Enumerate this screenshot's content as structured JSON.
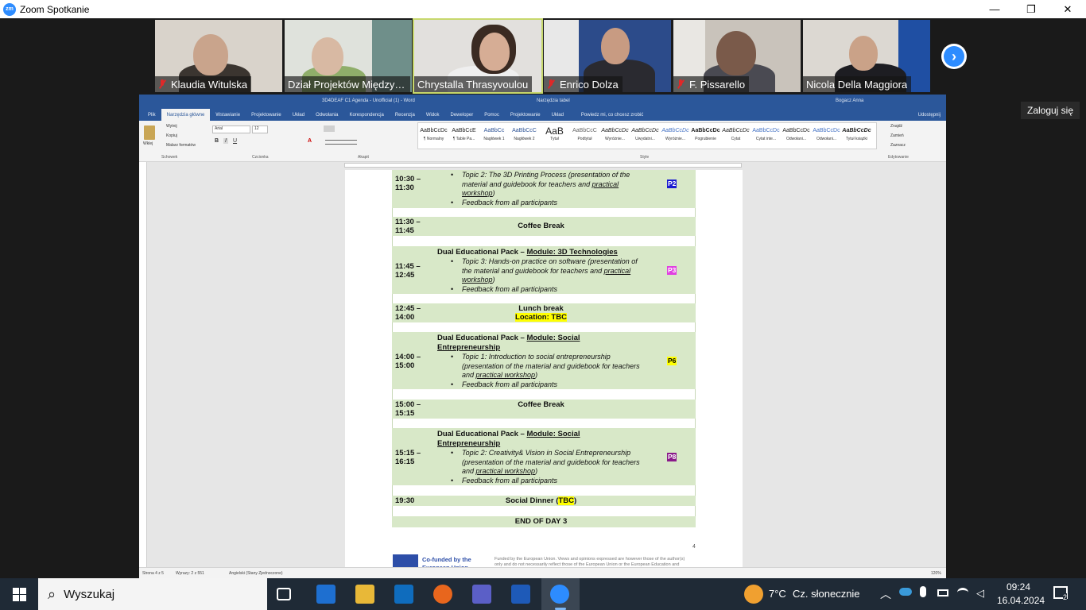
{
  "window": {
    "logo": "zm",
    "title": "Zoom Spotkanie",
    "minimize": "—",
    "maximize": "❐",
    "close": "✕"
  },
  "participants": [
    {
      "name": "Klaudia Witulska",
      "muted": true
    },
    {
      "name": "Dział Projektów Międzyn...",
      "muted": false
    },
    {
      "name": "Chrystalla Thrasyvoulou",
      "muted": false,
      "active": true
    },
    {
      "name": "Enrico Dolza",
      "muted": true
    },
    {
      "name": "F. Pissarello",
      "muted": true
    },
    {
      "name": "Nicola Della Maggiora",
      "muted": false
    }
  ],
  "next_icon": "›",
  "login_tooltip": "Zaloguj się",
  "word": {
    "doc_title": "3D4DEAF C1 Agenda - Unofficial (1) - Word",
    "context_tab": "Narzędzia tabel",
    "user": "Bogacz Anna",
    "tabs": [
      "Plik",
      "Narzędzia główne",
      "Wstawianie",
      "Projektowanie",
      "Układ",
      "Odwołania",
      "Korespondencja",
      "Recenzja",
      "Widok",
      "Deweloper",
      "Pomoc",
      "Projektowanie",
      "Układ"
    ],
    "tell_me": "Powiedz mi, co chcesz zrobić",
    "share": "Udostępnij",
    "clipboard": {
      "paste": "Wklej",
      "cut": "Wytnij",
      "copy": "Kopiuj",
      "painter": "Malarz formatów",
      "label": "Schowek"
    },
    "font": {
      "name": "Arial",
      "size": "12",
      "label": "Czcionka"
    },
    "paragraph_label": "Akapit",
    "styles_label": "Style",
    "styles": [
      {
        "sample": "AaBbCcDc",
        "name": "¶ Normalny"
      },
      {
        "sample": "AaBbCcE",
        "name": "¶ Table Pa..."
      },
      {
        "sample": "AaBbCc",
        "name": "Nagłówek 1"
      },
      {
        "sample": "AaBbCcC",
        "name": "Nagłówek 2"
      },
      {
        "sample": "AaB",
        "name": "Tytuł"
      },
      {
        "sample": "AaBbCcC",
        "name": "Podtytuł"
      },
      {
        "sample": "AaBbCcDc",
        "name": "Wyróżnie..."
      },
      {
        "sample": "AaBbCcDc",
        "name": "Uwydatni..."
      },
      {
        "sample": "AaBbCcDc",
        "name": "Wyróżnie..."
      },
      {
        "sample": "AaBbCcDc",
        "name": "Pogrubienie"
      },
      {
        "sample": "AaBbCcDc",
        "name": "Cytat"
      },
      {
        "sample": "AaBbCcDc",
        "name": "Cytat inte..."
      },
      {
        "sample": "AaBbCcDc",
        "name": "Odwołani..."
      },
      {
        "sample": "AaBbCcDc",
        "name": "Odwołani..."
      },
      {
        "sample": "AaBbCcDc",
        "name": "Tytuł książki"
      }
    ],
    "editing": {
      "find": "Znajdź",
      "replace": "Zamień",
      "select": "Zaznacz",
      "label": "Edytowanie"
    },
    "status": {
      "page": "Strona 4 z 5",
      "words": "Wyrazy: 2 z 551",
      "lang": "Angielski (Stany Zjednoczone)",
      "zoom": "120%"
    }
  },
  "agenda": {
    "r1": {
      "time": "10:30 – 11:30",
      "b1a": "Topic 2: The 3D Printing Process (presentation of the material and guidebook for teachers and ",
      "b1u": "practical workshop",
      "b1z": ")",
      "b2": "Feedback from all participants",
      "badge": "P2",
      "badge_color": "#1a1ad0"
    },
    "r2": {
      "time": "11:30 – 11:45",
      "title": "Coffee Break"
    },
    "r3": {
      "time": "11:45 – 12:45",
      "head_a": "Dual Educational Pack – ",
      "head_u": "Module: 3D Technologies",
      "b1a": "Topic 3: Hands-on practice on software (presentation of the material and guidebook for teachers and ",
      "b1u": "practical workshop",
      "b1z": ")",
      "b2": "Feedback from all participants",
      "badge": "P3",
      "badge_color": "#e040e0"
    },
    "r4": {
      "time": "12:45 – 14:00",
      "title": "Lunch break",
      "sub": "Location: TBC"
    },
    "r5": {
      "time": "14:00 – 15:00",
      "head_a": "Dual Educational Pack – ",
      "head_u": "Module: Social Entrepreneurship",
      "b1a": "Topic 1: Introduction to social entrepreneurship (presentation of the material and guidebook for teachers and ",
      "b1u": "practical workshop",
      "b1z": ")",
      "b2": "Feedback from all participants",
      "badge": "P6",
      "badge_color": "#ffff00"
    },
    "r6": {
      "time": "15:00 – 15:15",
      "title": "Coffee Break"
    },
    "r7": {
      "time": "15:15 – 16:15",
      "head_a": "Dual Educational Pack – ",
      "head_u": "Module: Social Entrepreneurship",
      "b1a": "Topic 2: Creativity& Vision in Social Entrepreneurship (presentation of the material and guidebook for teachers and ",
      "b1u": "practical workshop",
      "b1z": ")",
      "b2": "Feedback from all participants",
      "badge": "P8",
      "badge_color": "#8a1a8a"
    },
    "r8": {
      "time": "19:30",
      "title_a": "Social Dinner (",
      "title_h": "TBC",
      "title_z": ")"
    },
    "r9": {
      "title": "END OF DAY 3"
    },
    "page_number": "4",
    "footer_title": "Co-funded by the European Union",
    "footer_note": "Funded by the European Union. Views and opinions expressed are however those of the author(s) only and do not necessarily reflect those of the European Union or the European Education and"
  },
  "taskbar": {
    "search_icon": "⌕",
    "search": "Wyszukaj",
    "weather_temp": "7°C",
    "weather_desc": "Cz. słonecznie",
    "time": "09:24",
    "date": "16.04.2024",
    "notifications": "2",
    "apps": [
      "task-view",
      "microsoft-store",
      "file-explorer",
      "outlook",
      "firefox",
      "teams",
      "word",
      "zoom"
    ]
  }
}
